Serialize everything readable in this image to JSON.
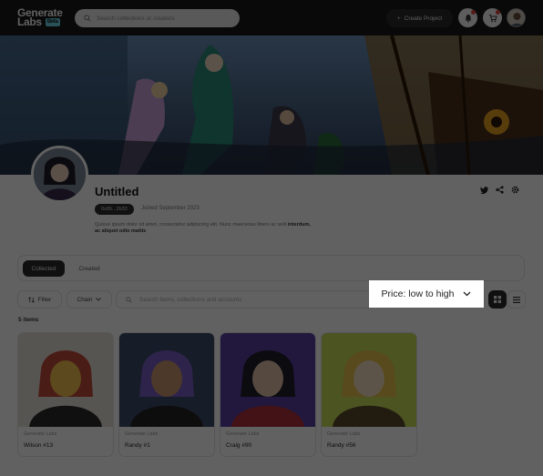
{
  "header": {
    "logo_line1": "Generate",
    "logo_line2": "Labs",
    "logo_badge": "Beta",
    "search_placeholder": "Search collections or creators",
    "create_label": "Create Project"
  },
  "profile": {
    "name": "Untitled",
    "handle": "0x85...2b33",
    "joined": "Joined September 2023",
    "bio_text": "Quisve ipsum dolor sit amet, consectetur adipiscing elit. Nunc maecenas libero ac velit",
    "bio_bold": "interdum, ac aliquet odio mattis"
  },
  "tabs": [
    {
      "label": "Collected",
      "active": true
    },
    {
      "label": "Created",
      "active": false
    }
  ],
  "toolbar": {
    "filter_label": "Filter",
    "chain_label": "Chain",
    "search_placeholder": "Search items, collections and accounts",
    "sort_label": "Price: low to high"
  },
  "items_count": "5 items",
  "cards": [
    {
      "creator": "Generate Labs",
      "title": "Wilson #13",
      "palette": [
        "#e5e0d8",
        "#c24a3a",
        "#f2c14e",
        "#2a2a2a"
      ]
    },
    {
      "creator": "Generate Labs",
      "title": "Randy #1",
      "palette": [
        "#3b4a6a",
        "#7a5fc4",
        "#c7956e",
        "#222"
      ]
    },
    {
      "creator": "Generate Labs",
      "title": "Craig #90",
      "palette": [
        "#5a3fa0",
        "#1e1e2a",
        "#e3c2a8",
        "#b0303a"
      ]
    },
    {
      "creator": "Generate Labs",
      "title": "Randy #56",
      "palette": [
        "#c8dc5a",
        "#e8c24a",
        "#f2dcc0",
        "#5a4a2a"
      ]
    }
  ],
  "colors": {
    "dim_overlay": "rgba(0,0,0,0.62)",
    "accent_dark": "#2b2b2b",
    "notification_dot": "#e0453c"
  }
}
